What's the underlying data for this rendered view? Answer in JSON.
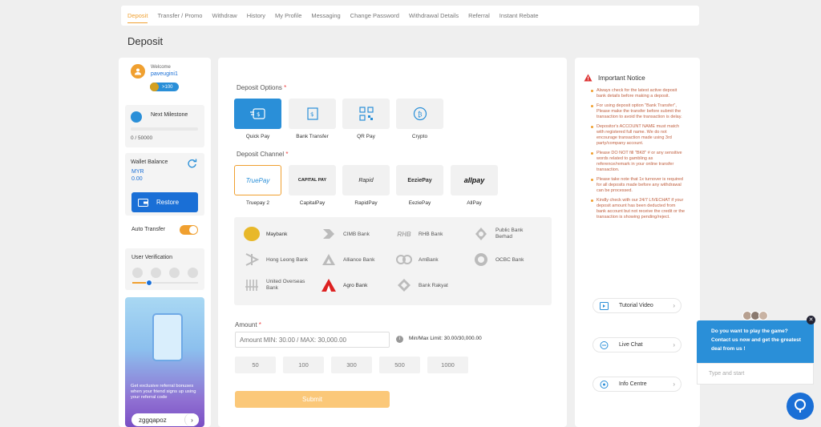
{
  "tabs": [
    "Deposit",
    "Transfer / Promo",
    "Withdraw",
    "History",
    "My Profile",
    "Messaging",
    "Change Password",
    "Withdrawal Details",
    "Referral",
    "Instant Rebate"
  ],
  "page_title": "Deposit",
  "user": {
    "welcome": "Welcome",
    "username": "paveugini1",
    "points": ">100"
  },
  "milestone": {
    "label": "Next Milestone",
    "value": "0 / 50000"
  },
  "wallet": {
    "label": "Wallet Balance",
    "currency": "MYR",
    "amount": "0.00",
    "restore": "Restore"
  },
  "auto_transfer": {
    "label": "Auto Transfer",
    "on": true
  },
  "verification": {
    "label": "User Verification"
  },
  "referral": {
    "text": "Get exclusive referral bonuses when your friend signs up using your referral code",
    "code": "zggqapoz"
  },
  "deposit_options": {
    "label": "Deposit Options",
    "items": [
      "Quick Pay",
      "Bank Transfer",
      "QR Pay",
      "Crypto"
    ]
  },
  "deposit_channel": {
    "label": "Deposit Channel",
    "items": [
      {
        "name": "Truepay 2",
        "logo": "TruePay"
      },
      {
        "name": "CapitalPay",
        "logo": "CAPITAL PAY"
      },
      {
        "name": "RapidPay",
        "logo": "Rapid"
      },
      {
        "name": "EeziePay",
        "logo": "EeziePay"
      },
      {
        "name": "AllPay",
        "logo": "allpay"
      }
    ]
  },
  "banks": [
    "Maybank",
    "CIMB Bank",
    "RHB Bank",
    "Public Bank Berhad",
    "Hong Leong Bank",
    "Alliance Bank",
    "AmBank",
    "OCBC Bank",
    "United Overseas Bank",
    "Agro Bank",
    "Bank Rakyat"
  ],
  "amount": {
    "label": "Amount",
    "placeholder": "Amount MIN: 30.00 / MAX: 30,000.00",
    "limit": "Min/Max Limit: 30.00/30,000.00",
    "quick": [
      "50",
      "100",
      "300",
      "500",
      "1000"
    ],
    "submit": "Submit"
  },
  "notice": {
    "title": "Important Notice",
    "items": [
      "Always check for the latest active deposit bank details before making a deposit.",
      "For using deposit option \"Bank Transfer\", Please make the transfer before submit the transaction to avoid the transaction is delay.",
      "Depositor's ACCOUNT NAME must match with registered full name. We do not encourage transaction made using 3rd party/company account.",
      "Please DO NOT fill \"BK8\" # or any sensitive words related to gambling as reference/remark in your online transfer transaction.",
      "Please take note that 1x turnover is required for all deposits made before any withdrawal can be processed.",
      "Kindly check with our 24/7 LIVECHAT if your deposit amount has been deducted from bank account but not receive the credit or the transaction is showing pending/reject."
    ]
  },
  "side_buttons": [
    "Tutorial Video",
    "Live Chat",
    "Info Centre"
  ],
  "chat": {
    "message": "Do you want to play the game? Contact us now and get the greatest deal from us !",
    "placeholder": "Type and start"
  },
  "colors": {
    "accent": "#f0a030",
    "primary": "#1a6fd6",
    "chat": "#2a8fd8"
  }
}
